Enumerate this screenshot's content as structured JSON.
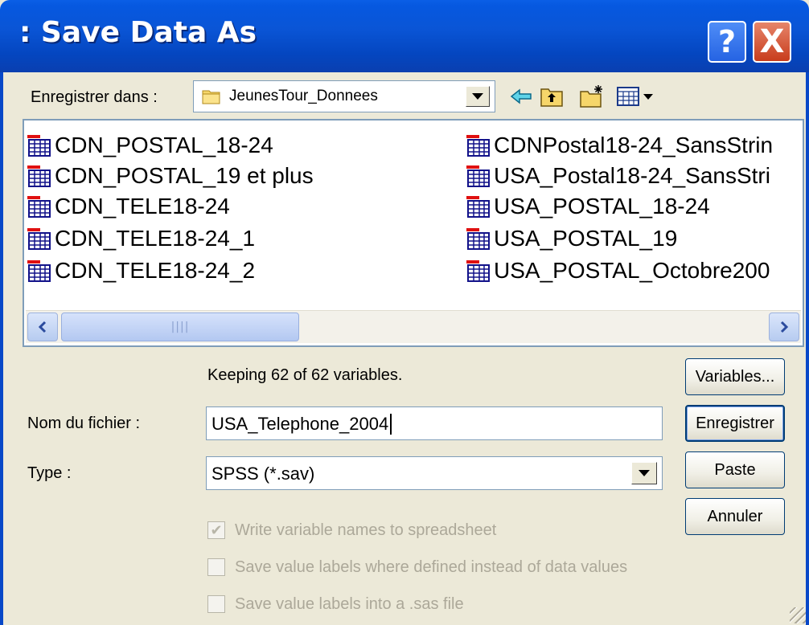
{
  "window": {
    "title": ": Save Data As",
    "help_glyph": "?",
    "close_glyph": "X"
  },
  "look_in": {
    "label": "Enregistrer dans :",
    "value": "JeunesTour_Donnees"
  },
  "toolbar": {
    "icons": [
      "back-arrow-icon",
      "up-folder-icon",
      "new-folder-icon",
      "view-menu-icon"
    ]
  },
  "files": {
    "left": [
      "CDN_POSTAL_18-24",
      "CDN_POSTAL_19 et plus",
      "CDN_TELE18-24",
      "CDN_TELE18-24_1",
      "CDN_TELE18-24_2"
    ],
    "right": [
      "CDNPostal18-24_SansStrin",
      "USA_Postal18-24_SansStri",
      "USA_POSTAL_18-24",
      "USA_POSTAL_19",
      "USA_POSTAL_Octobre200"
    ]
  },
  "status": "Keeping 62 of 62 variables.",
  "filename": {
    "label": "Nom du fichier :",
    "value": "USA_Telephone_2004"
  },
  "type": {
    "label": "Type :",
    "value": "SPSS (*.sav)"
  },
  "buttons": {
    "variables": "Variables...",
    "save": "Enregistrer",
    "paste": "Paste",
    "cancel": "Annuler"
  },
  "options": [
    {
      "label": "Write variable names to spreadsheet",
      "checked": true,
      "enabled": false
    },
    {
      "label": "Save value labels where defined instead of data values",
      "checked": false,
      "enabled": false
    },
    {
      "label": "Save value labels into a .sas file",
      "checked": false,
      "enabled": false
    }
  ],
  "colors": {
    "titlebar": "#0a55d6",
    "dialog_bg": "#ece9d8",
    "disabled_text": "#aca899",
    "close_button": "#d2502c"
  }
}
